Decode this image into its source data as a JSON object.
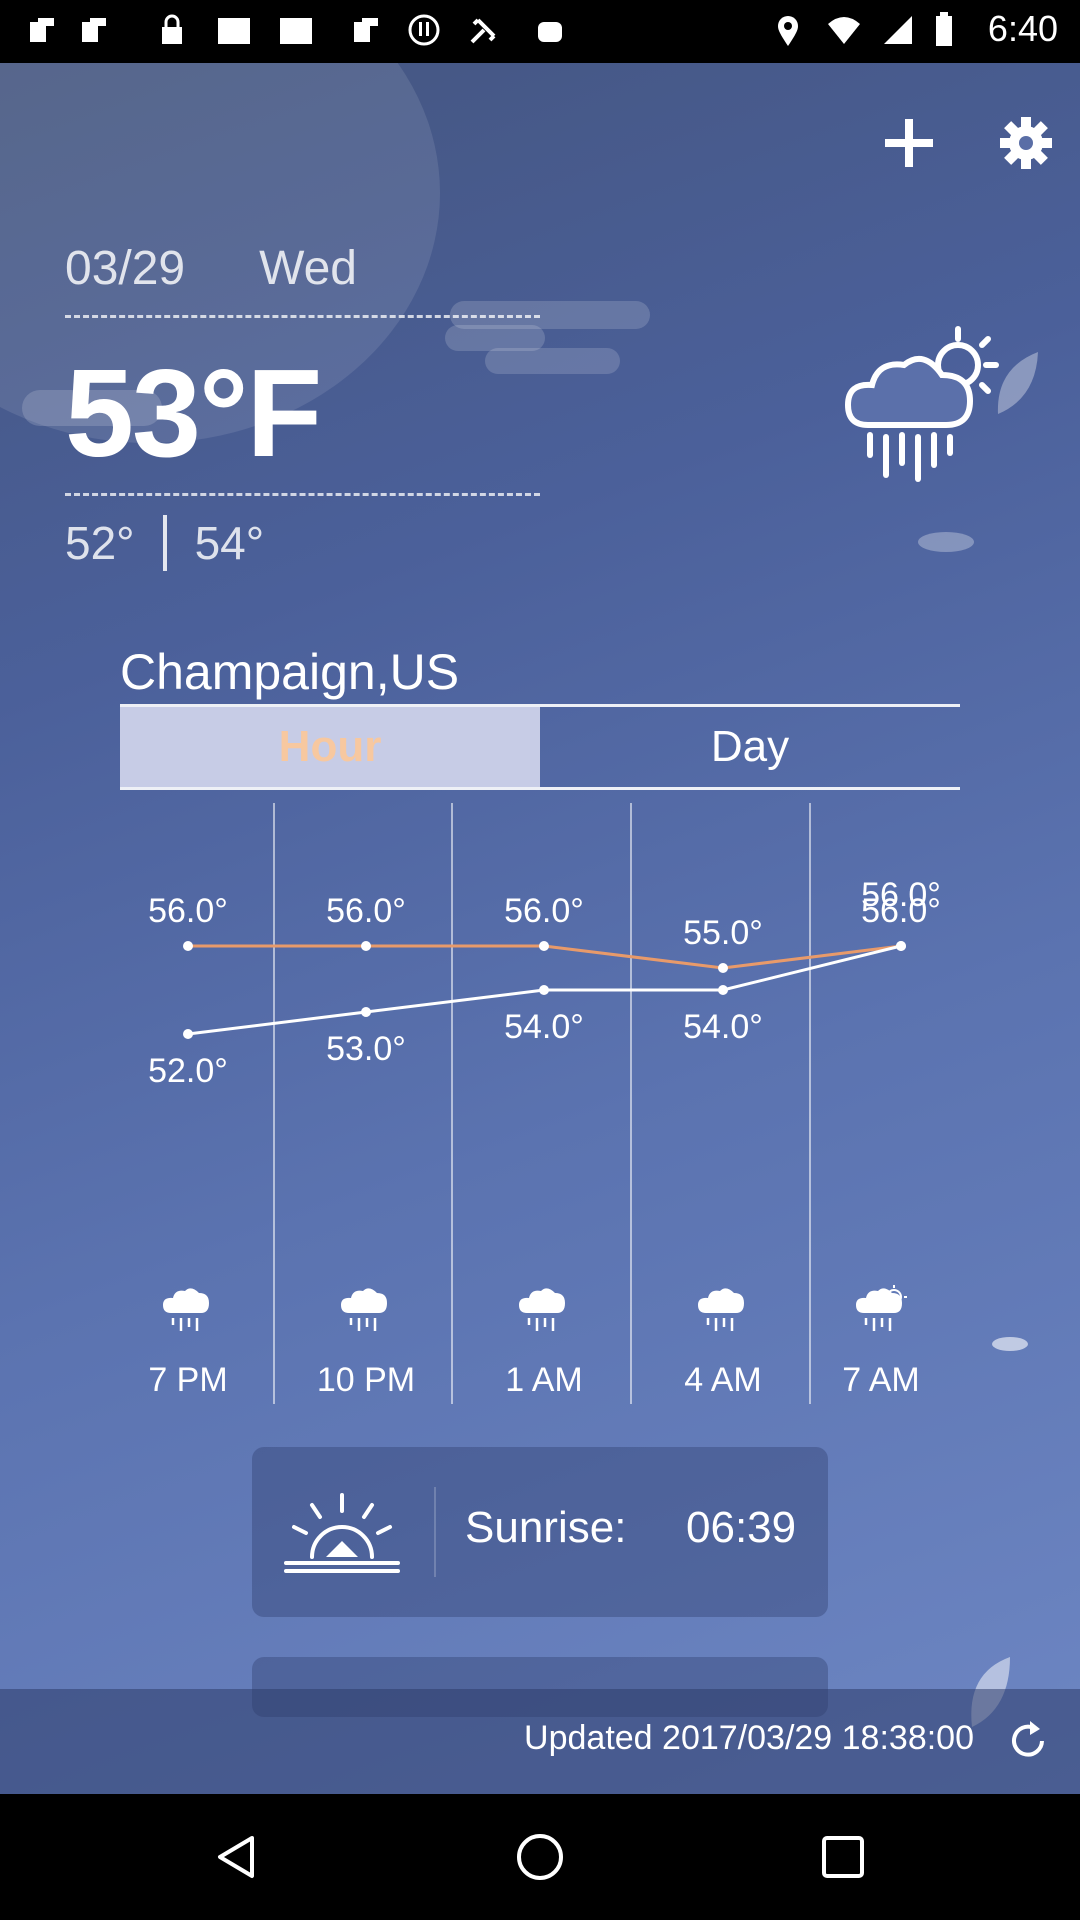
{
  "status_bar": {
    "time": "6:40",
    "left_icons": [
      "notification-icon",
      "notification-icon",
      "lock-icon",
      "image-icon",
      "image-icon",
      "notification-icon",
      "download-icon",
      "satellite-icon",
      "android-icon"
    ],
    "right_icons": [
      "location-icon",
      "wifi-icon",
      "signal-icon",
      "battery-icon"
    ]
  },
  "header": {
    "date": "03/29",
    "weekday": "Wed",
    "current_temp": "53°F",
    "low": "52°",
    "high": "54°",
    "condition_icon": "rain-sun-cloud-icon"
  },
  "location": {
    "city": "Champaign,US"
  },
  "tabs": [
    {
      "label": "Hour",
      "active": true
    },
    {
      "label": "Day",
      "active": false
    }
  ],
  "hourly": [
    {
      "time": "7 PM",
      "high": "56.0°",
      "low": "52.0°"
    },
    {
      "time": "10 PM",
      "high": "56.0°",
      "low": "53.0°"
    },
    {
      "time": "1 AM",
      "high": "56.0°",
      "low": "54.0°"
    },
    {
      "time": "4 AM",
      "high": "55.0°",
      "low": "54.0°"
    },
    {
      "time": "7 AM",
      "high": "56.0°",
      "low": "56.0°"
    }
  ],
  "chart_data": {
    "type": "line",
    "categories": [
      "7 PM",
      "10 PM",
      "1 AM",
      "4 AM",
      "7 AM"
    ],
    "series": [
      {
        "values": [
          56.0,
          56.0,
          56.0,
          55.0,
          56.0
        ],
        "color": "#e89a6a"
      },
      {
        "values": [
          52.0,
          53.0,
          54.0,
          54.0,
          56.0
        ],
        "color": "#ffffff"
      }
    ]
  },
  "sunrise": {
    "label": "Sunrise:",
    "time": "06:39"
  },
  "footer": {
    "updated": "Updated 2017/03/29 18:38:00"
  },
  "colors": {
    "accent_tab_text": "#f7c8a0",
    "high_line": "#e89a6a",
    "low_line": "#ffffff"
  }
}
